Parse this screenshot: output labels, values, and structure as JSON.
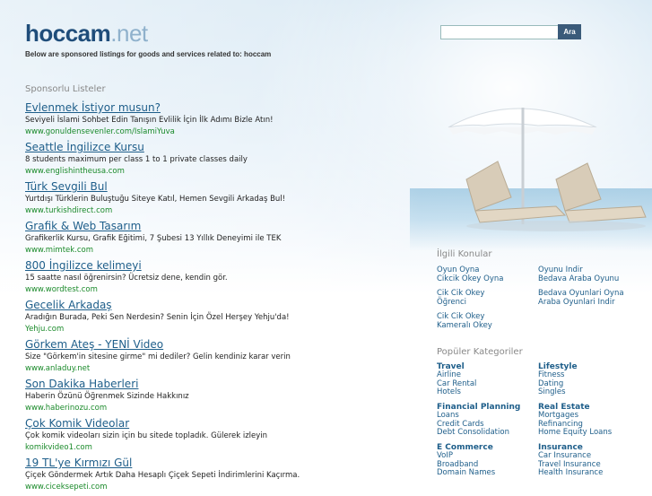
{
  "header": {
    "logo_main": "hoccam",
    "logo_tld": ".net",
    "tagline": "Below are sponsored listings for goods and services related to: hoccam"
  },
  "search": {
    "value": "",
    "button_label": "Ara"
  },
  "sponsored": {
    "title": "Sponsorlu Listeler",
    "items": [
      {
        "title": "Evlenmek İstiyor musun?",
        "desc": "Seviyeli İslami Sohbet Edin Tanışın Evlilik İçin İlk Adımı Bizle Atın!",
        "url": "www.gonuldensevenler.com/IslamiYuva"
      },
      {
        "title": "Seattle İngilizce Kursu",
        "desc": "8 students maximum per class 1 to 1 private classes daily",
        "url": "www.englishintheusa.com"
      },
      {
        "title": "Türk Sevgili Bul",
        "desc": "Yurtdışı Türklerin Buluştuğu Siteye Katıl, Hemen Sevgili Arkadaş Bul!",
        "url": "www.turkishdirect.com"
      },
      {
        "title": "Grafik & Web Tasarım",
        "desc": "Grafikerlik Kursu, Grafik Eğitimi, 7 Şubesi 13 Yıllık Deneyimi ile TEK",
        "url": "www.mimtek.com"
      },
      {
        "title": "800 İngilizce kelimeyi",
        "desc": "15 saatte nasıl öğrenirsin? Ücretsiz dene, kendin gör.",
        "url": "www.wordtest.com"
      },
      {
        "title": "Gecelik Arkadaş",
        "desc": "Aradığın Burada, Peki Sen Nerdesin? Senin İçin Özel Herşey Yehju'da!",
        "url": "Yehju.com"
      },
      {
        "title": "Görkem Ateş - YENİ Video",
        "desc": "Size \"Görkem'in sitesine girme\" mi dediler? Gelin kendiniz karar verin",
        "url": "www.anladuy.net"
      },
      {
        "title": "Son Dakika Haberleri",
        "desc": "Haberin Özünü Öğrenmek Sizinde Hakkınız",
        "url": "www.haberinozu.com"
      },
      {
        "title": "Çok Komik Videolar",
        "desc": "Çok komik videoları sizin için bu sitede topladık. Gülerek izleyin",
        "url": "komikvideo1.com"
      },
      {
        "title": "19 TL'ye Kırmızı Gül",
        "desc": "Çiçek Göndermek Artık Daha Hesaplı Çiçek Sepeti İndirimlerini Kaçırma.",
        "url": "www.ciceksepeti.com"
      }
    ]
  },
  "related": {
    "title": "İlgili Konular",
    "left": [
      {
        "lines": [
          "Oyun Oyna"
        ]
      },
      {
        "lines": [
          "Cikcik Okey Oyna"
        ]
      },
      {
        "lines": [
          "Cik Cik Okey",
          "Öğrenci"
        ]
      },
      {
        "lines": [
          "Cik Cik Okey",
          "Kameralı Okey"
        ]
      }
    ],
    "right": [
      {
        "lines": [
          "Oyunu Indir"
        ]
      },
      {
        "lines": [
          "Bedava Araba Oyunu"
        ]
      },
      {
        "lines": [
          "Bedava Oyunlari Oyna"
        ]
      },
      {
        "lines": [
          "Araba Oyunlari Indir"
        ]
      }
    ]
  },
  "popular": {
    "title": "Popüler Kategoriler",
    "cats": [
      {
        "heading": "Travel",
        "items": [
          "Airline",
          "Car Rental",
          "Hotels"
        ]
      },
      {
        "heading": "Lifestyle",
        "items": [
          "Fitness",
          "Dating",
          "Singles"
        ]
      },
      {
        "heading": "Financial Planning",
        "items": [
          "Loans",
          "Credit Cards",
          "Debt Consolidation"
        ]
      },
      {
        "heading": "Real Estate",
        "items": [
          "Mortgages",
          "Refinancing",
          "Home Equity Loans"
        ]
      },
      {
        "heading": "E Commerce",
        "items": [
          "VoIP",
          "Broadband",
          "Domain Names"
        ]
      },
      {
        "heading": "Insurance",
        "items": [
          "Car Insurance",
          "Travel Insurance",
          "Health Insurance"
        ]
      }
    ]
  }
}
